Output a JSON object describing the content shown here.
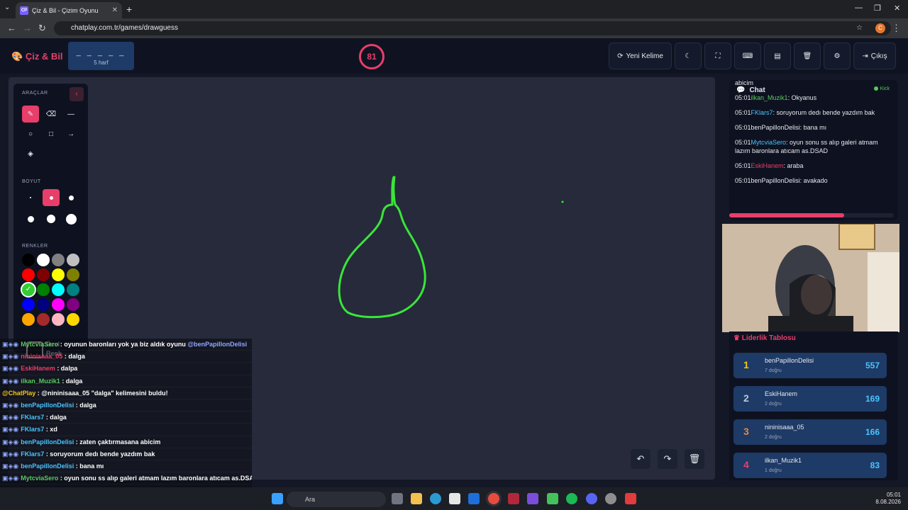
{
  "browser": {
    "tab_title": "Çiz & Bil - Çizim Oyunu",
    "tab_favicon": "CP",
    "url": "chatplay.com.tr/games/drawguess",
    "profile_initial": "C"
  },
  "header": {
    "logo": "Çiz & Bil",
    "word_mask": "_ _ _ _ _",
    "word_length": "5 harf",
    "timer": "81",
    "new_word_label": "Yeni Kelime",
    "exit_label": "Çıkış"
  },
  "tools": {
    "section_tools": "ARAÇLAR",
    "section_size": "BOYUT",
    "section_colors": "RENKLER",
    "custom_color": "Özel Renk",
    "colors": [
      "#000000",
      "#ffffff",
      "#808080",
      "#c0c0c0",
      "#ff0000",
      "#800000",
      "#ffff00",
      "#808000",
      "#32cd32",
      "#008000",
      "#00ffff",
      "#008080",
      "#0000ff",
      "#000080",
      "#ff00ff",
      "#800080",
      "#ffa500",
      "#a52a2a",
      "#ffb6c1",
      "#ffd700"
    ],
    "active_color": "#32cd32"
  },
  "chat": {
    "title": "Chat",
    "status": "Kick",
    "messages": [
      {
        "text": "abicim"
      },
      {
        "time": "05:01",
        "user": "ilkan_Muzik1",
        "color": "#58c85f",
        "text": ": Okyanus"
      },
      {
        "time": "05:01",
        "user": "FKlars7",
        "color": "#49c4ff",
        "text": ": soruyorum dedı bende yazdım bak"
      },
      {
        "time": "05:01",
        "user": "benPapillonDelisi",
        "color": "#e6e8ef",
        "text": ": bana mı"
      },
      {
        "time": "05:01",
        "user": "MytcviaSero",
        "color": "#49c4ff",
        "text": ": oyun sonu ss alıp galeri atmam lazım baronlara atıcam as.DSAD"
      },
      {
        "time": "05:01",
        "user": "EskiHanem",
        "color": "#e83e6a",
        "text": ": araba"
      },
      {
        "time": "05:01",
        "user": "benPapillonDelisi",
        "color": "#e6e8ef",
        "text": ": avakado"
      }
    ],
    "round_progress": 0.7
  },
  "leaderboard": {
    "title": "Liderlik Tablosu",
    "rows": [
      {
        "rank": "1",
        "name": "benPapillonDelisi",
        "hits": "7 doğru",
        "score": "557",
        "rank_color": "#f5c518"
      },
      {
        "rank": "2",
        "name": "EskiHanem",
        "hits": "2 doğru",
        "score": "169",
        "rank_color": "#c0c6d2"
      },
      {
        "rank": "3",
        "name": "nininisaaa_05",
        "hits": "2 doğru",
        "score": "166",
        "rank_color": "#e6893a"
      },
      {
        "rank": "4",
        "name": "ilkan_Muzik1",
        "hits": "1 doğru",
        "score": "83",
        "rank_color": "#e83e6a"
      }
    ]
  },
  "stream_chat": [
    {
      "user": "MytcviaSero",
      "color": "#58c85f",
      "text": ": oyunun baronları yok ya biz aldık oyunu",
      "mention": "@benPapillonDelisi"
    },
    {
      "user": "nininisaaa_05",
      "color": "#e83e6a",
      "text": ": dalga"
    },
    {
      "user": "EskiHanem",
      "color": "#e83e6a",
      "text": ": dalpa"
    },
    {
      "user": "ilkan_Muzik1",
      "color": "#58c85f",
      "text": ": dalga"
    },
    {
      "user": "@ChatPlay",
      "color": "#f5c518",
      "text": " : @nininisaaa_05 \"dalga\" kelimesini buldu!"
    },
    {
      "user": "benPapillonDelisi",
      "color": "#49c4ff",
      "text": ": dalga"
    },
    {
      "user": "FKlars7",
      "color": "#49c4ff",
      "text": ": dalga"
    },
    {
      "user": "FKlars7",
      "color": "#49c4ff",
      "text": ": xd"
    },
    {
      "user": "benPapillonDelisi",
      "color": "#49c4ff",
      "text": ": zaten çaktırmasana abicim"
    },
    {
      "user": "FKlars7",
      "color": "#49c4ff",
      "text": ": soruyorum dedı bende yazdım bak"
    },
    {
      "user": "benPapillonDelisi",
      "color": "#49c4ff",
      "text": ": bana mı"
    },
    {
      "user": "MytcviaSero",
      "color": "#58c85f",
      "text": ": oyun sonu ss alıp galeri atmam lazım baronlara atıcam as.DSAD"
    },
    {
      "user": "EskiHanem",
      "color": "#e83e6a",
      "text": ": araba"
    },
    {
      "user": "benPapillonDelisi",
      "color": "#49c4ff",
      "text": ": avakado"
    }
  ],
  "taskbar": {
    "search_placeholder": "Ara",
    "time": "05:01",
    "date": "8.08.2026"
  }
}
